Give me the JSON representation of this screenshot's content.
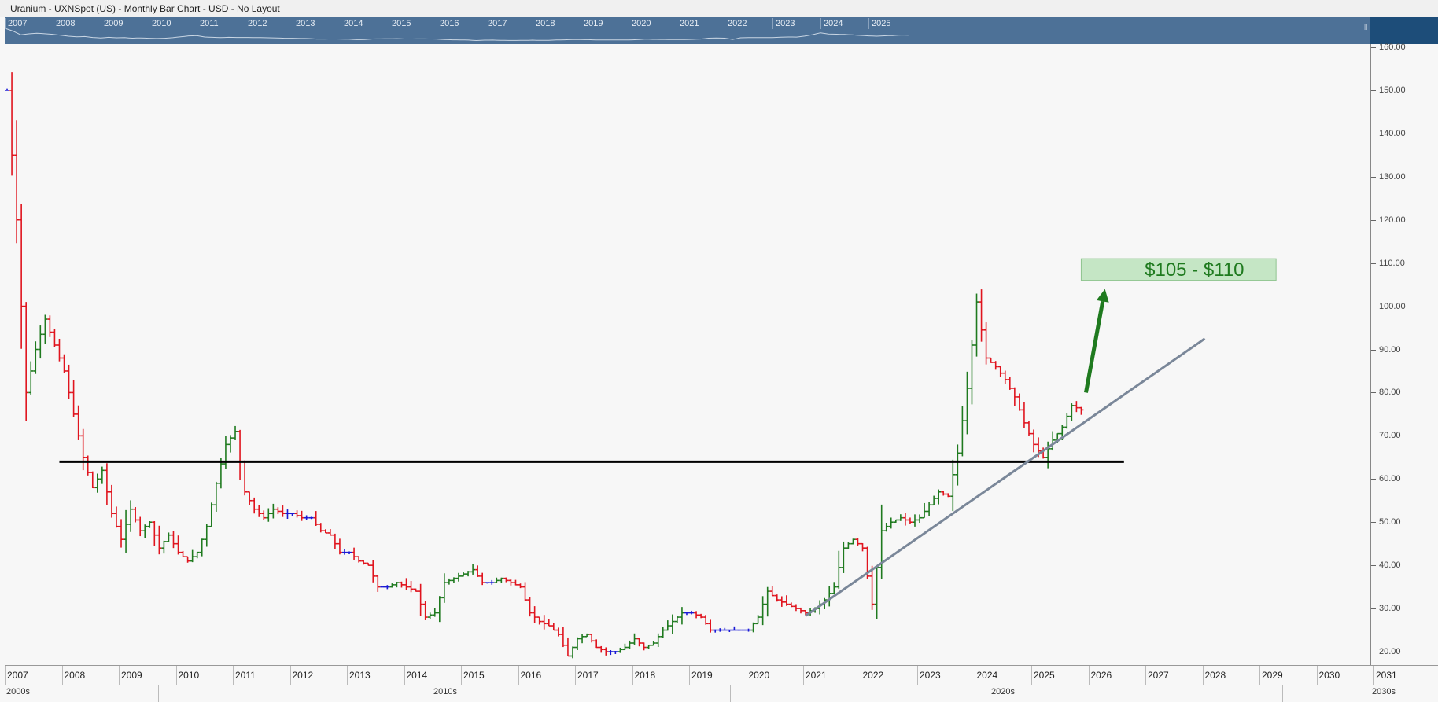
{
  "window_title": "Uranium - UXNSpot (US) - Monthly Bar Chart - USD - No Layout",
  "navigator": {
    "years": [
      "2007",
      "2008",
      "2009",
      "2010",
      "2011",
      "2012",
      "2013",
      "2014",
      "2015",
      "2016",
      "2017",
      "2018",
      "2019",
      "2020",
      "2021",
      "2022",
      "2023",
      "2024",
      "2025"
    ],
    "grip_icon": "grip-lines-icon"
  },
  "chart_data": {
    "type": "ohlc",
    "title": "Uranium - UXNSpot (US) - Monthly Bar Chart - USD",
    "interval": "Monthly",
    "currency": "USD",
    "x_axis": {
      "type": "date",
      "range": [
        "2007-01",
        "2031-12"
      ],
      "tick_labels": [
        "2007",
        "2008",
        "2009",
        "2010",
        "2011",
        "2012",
        "2013",
        "2014",
        "2015",
        "2016",
        "2017",
        "2018",
        "2019",
        "2020",
        "2021",
        "2022",
        "2023",
        "2024",
        "2025",
        "2026",
        "2027",
        "2028",
        "2029",
        "2030",
        "2031"
      ],
      "decade_labels": [
        "2000s",
        "2010s",
        "2020s",
        "2030s"
      ]
    },
    "y_axis": {
      "range": [
        16,
        162
      ],
      "tick_labels": [
        "160.00",
        "150.00",
        "140.00",
        "130.00",
        "120.00",
        "110.00",
        "100.00",
        "90.00",
        "80.00",
        "70.00",
        "60.00",
        "50.00",
        "40.00",
        "30.00",
        "20.00"
      ],
      "side": "right"
    },
    "colors": {
      "up": "#1f7a1f",
      "down": "#e0141e",
      "neutral": "#1a1ad6"
    },
    "price_points": [
      [
        "2007-01",
        150
      ],
      [
        "2007-03",
        120
      ],
      [
        "2007-05",
        80
      ],
      [
        "2007-07",
        90
      ],
      [
        "2007-09",
        97
      ],
      [
        "2007-11",
        91
      ],
      [
        "2008-01",
        85
      ],
      [
        "2008-03",
        75
      ],
      [
        "2008-05",
        65
      ],
      [
        "2008-07",
        58
      ],
      [
        "2008-09",
        62
      ],
      [
        "2008-11",
        52
      ],
      [
        "2009-01",
        46
      ],
      [
        "2009-03",
        53
      ],
      [
        "2009-05",
        48
      ],
      [
        "2009-07",
        50
      ],
      [
        "2009-09",
        44
      ],
      [
        "2009-11",
        47
      ],
      [
        "2010-01",
        43
      ],
      [
        "2010-03",
        41
      ],
      [
        "2010-05",
        43
      ],
      [
        "2010-07",
        49
      ],
      [
        "2010-09",
        59
      ],
      [
        "2010-11",
        68
      ],
      [
        "2011-01",
        71
      ],
      [
        "2011-03",
        57
      ],
      [
        "2011-05",
        53
      ],
      [
        "2011-07",
        51
      ],
      [
        "2011-09",
        53
      ],
      [
        "2011-11",
        52
      ],
      [
        "2012-01",
        52
      ],
      [
        "2012-03",
        51
      ],
      [
        "2012-05",
        51
      ],
      [
        "2012-07",
        48
      ],
      [
        "2012-09",
        47
      ],
      [
        "2012-11",
        43
      ],
      [
        "2013-01",
        43
      ],
      [
        "2013-03",
        41
      ],
      [
        "2013-05",
        40
      ],
      [
        "2013-07",
        35
      ],
      [
        "2013-09",
        35
      ],
      [
        "2013-11",
        36
      ],
      [
        "2014-01",
        35
      ],
      [
        "2014-03",
        34
      ],
      [
        "2014-05",
        28
      ],
      [
        "2014-07",
        29
      ],
      [
        "2014-09",
        36
      ],
      [
        "2014-11",
        37
      ],
      [
        "2015-01",
        38
      ],
      [
        "2015-03",
        39
      ],
      [
        "2015-05",
        36
      ],
      [
        "2015-07",
        36
      ],
      [
        "2015-09",
        37
      ],
      [
        "2015-11",
        36
      ],
      [
        "2016-01",
        35
      ],
      [
        "2016-03",
        29
      ],
      [
        "2016-05",
        27
      ],
      [
        "2016-07",
        26
      ],
      [
        "2016-09",
        24
      ],
      [
        "2016-11",
        19
      ],
      [
        "2017-01",
        23
      ],
      [
        "2017-03",
        24
      ],
      [
        "2017-05",
        21
      ],
      [
        "2017-07",
        20
      ],
      [
        "2017-09",
        20
      ],
      [
        "2017-11",
        21
      ],
      [
        "2018-01",
        23
      ],
      [
        "2018-03",
        21
      ],
      [
        "2018-05",
        22
      ],
      [
        "2018-07",
        25
      ],
      [
        "2018-09",
        27
      ],
      [
        "2018-11",
        29
      ],
      [
        "2019-01",
        29
      ],
      [
        "2019-03",
        28
      ],
      [
        "2019-05",
        25
      ],
      [
        "2019-07",
        25
      ],
      [
        "2019-09",
        25
      ],
      [
        "2019-11",
        25
      ],
      [
        "2020-01",
        25
      ],
      [
        "2020-03",
        28
      ],
      [
        "2020-05",
        34
      ],
      [
        "2020-07",
        32
      ],
      [
        "2020-09",
        31
      ],
      [
        "2020-11",
        30
      ],
      [
        "2021-01",
        29
      ],
      [
        "2021-03",
        30
      ],
      [
        "2021-05",
        32
      ],
      [
        "2021-07",
        35
      ],
      [
        "2021-09",
        44
      ],
      [
        "2021-11",
        46
      ],
      [
        "2022-01",
        44
      ],
      [
        "2022-03",
        31
      ],
      [
        "2022-05",
        48
      ],
      [
        "2022-07",
        50
      ],
      [
        "2022-09",
        51
      ],
      [
        "2022-11",
        50
      ],
      [
        "2023-01",
        51
      ],
      [
        "2023-05",
        57
      ],
      [
        "2023-07",
        56
      ],
      [
        "2023-09",
        66
      ],
      [
        "2023-11",
        81
      ],
      [
        "2024-01",
        101
      ],
      [
        "2024-03",
        88
      ],
      [
        "2024-05",
        86
      ],
      [
        "2024-07",
        83
      ],
      [
        "2024-09",
        79
      ],
      [
        "2024-11",
        73
      ],
      [
        "2025-01",
        68
      ],
      [
        "2025-03",
        65
      ],
      [
        "2025-05",
        69
      ],
      [
        "2025-07",
        72
      ],
      [
        "2025-09",
        77
      ],
      [
        "2025-11",
        76
      ]
    ],
    "annotations": [
      {
        "type": "horizontal_line",
        "y": 64,
        "x_range": [
          "2007-12",
          "2026-08"
        ],
        "color": "#000000",
        "label": ""
      },
      {
        "type": "trend_line",
        "from": [
          "2021-01",
          28.3
        ],
        "to": [
          "2028-01",
          92.5
        ],
        "color": "#7a8799",
        "label": ""
      },
      {
        "type": "arrow",
        "from": [
          "2025-12",
          80
        ],
        "to": [
          "2026-04",
          104
        ],
        "color": "#1f7a1f"
      },
      {
        "type": "text_box",
        "text": "$105 - $110",
        "x_range": [
          "2025-11",
          "2029-04"
        ],
        "y_range": [
          106,
          111
        ],
        "fill": "#c5e6c5",
        "text_color": "#1f7a1f"
      }
    ],
    "grid": false,
    "legend": "none"
  }
}
